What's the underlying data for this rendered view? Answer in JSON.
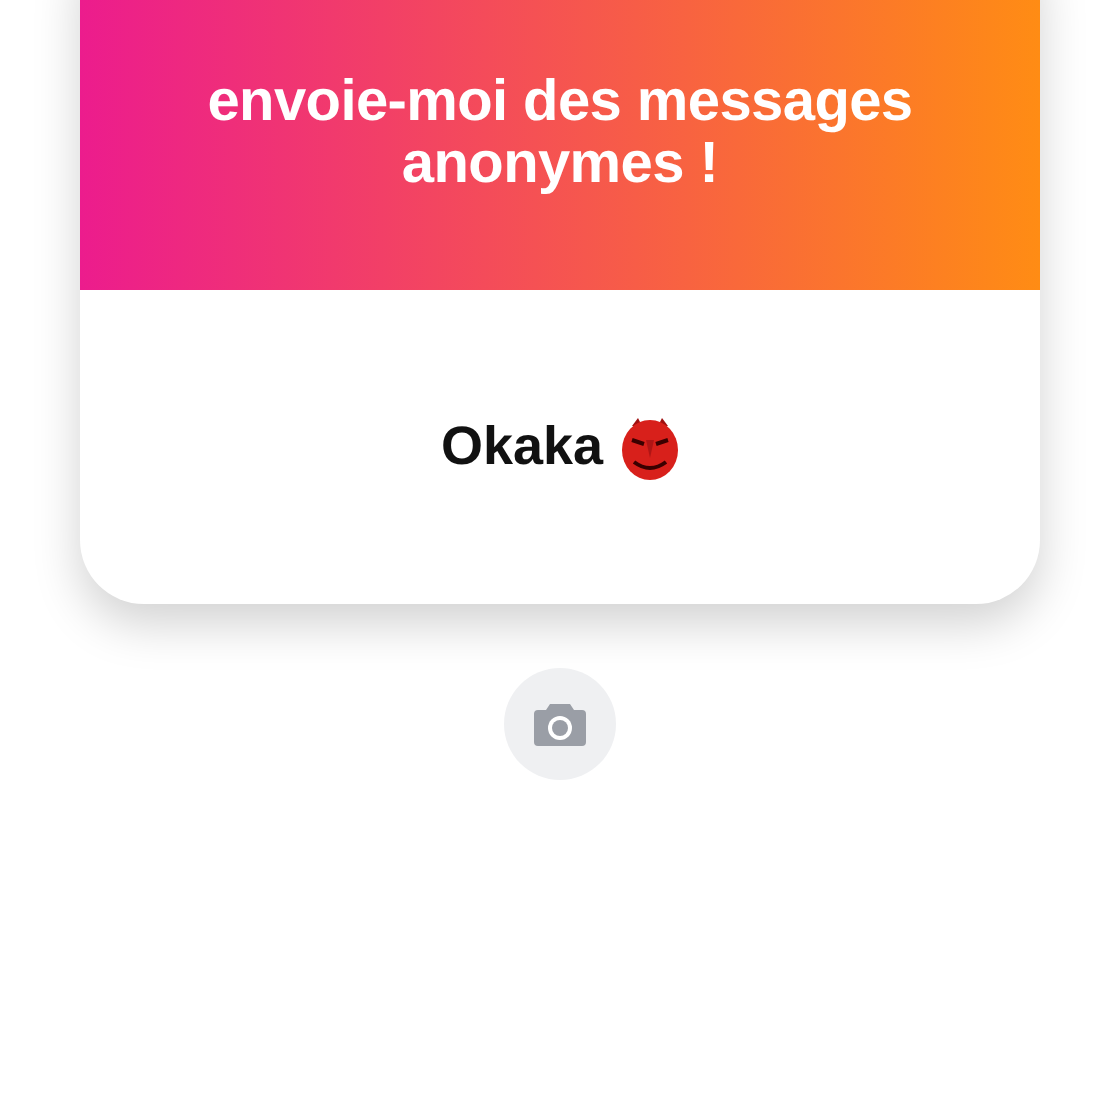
{
  "card": {
    "header": {
      "title": "envoie-moi des messages anonymes !"
    },
    "username": "Okaka"
  },
  "camera_button": {
    "disabled": false
  }
}
